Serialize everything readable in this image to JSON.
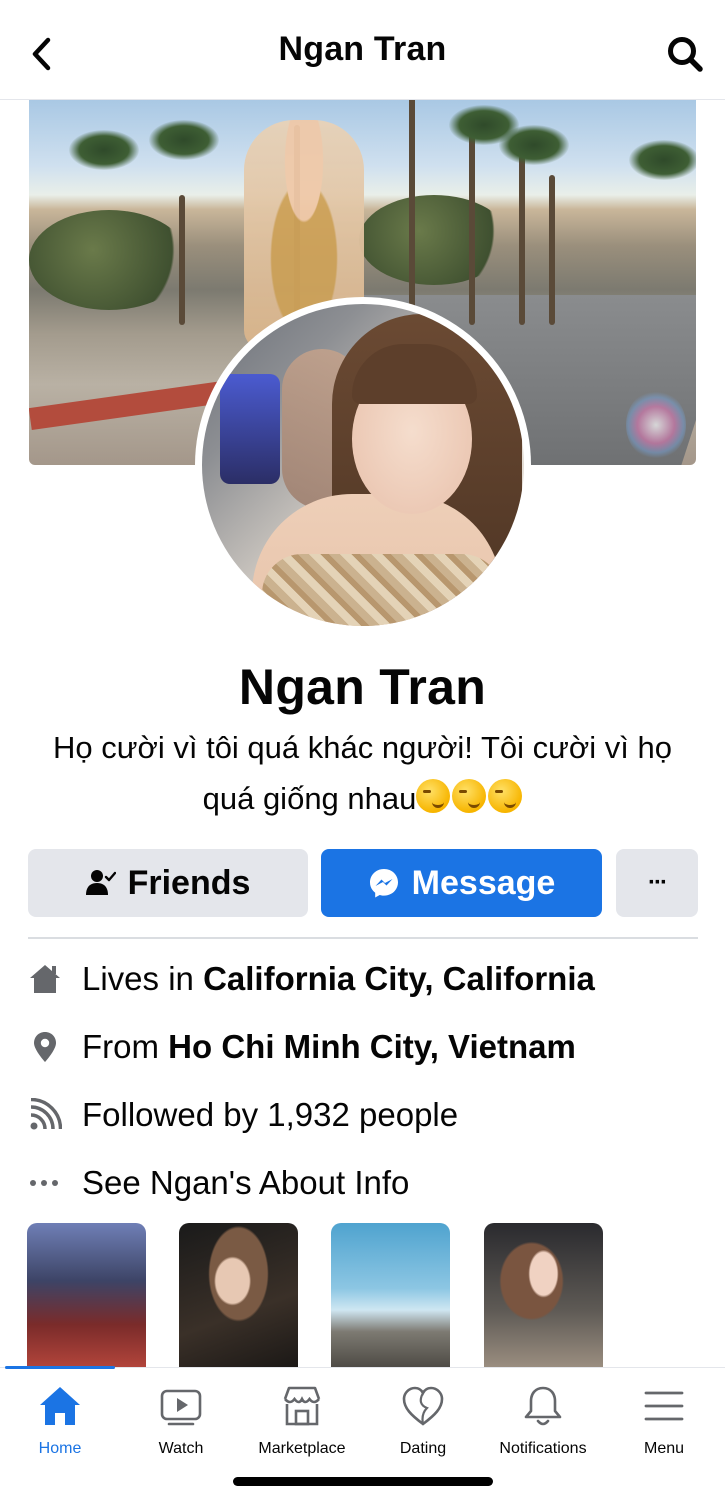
{
  "header": {
    "title": "Ngan Tran"
  },
  "profile": {
    "name": "Ngan Tran",
    "bio_line1": "Họ cười vì tôi quá khác người! Tôi cười vì họ",
    "bio_line2": "quá giống nhau"
  },
  "actions": {
    "friends_label": "Friends",
    "message_label": "Message",
    "more_label": "···"
  },
  "info": {
    "lives_prefix": "Lives in ",
    "lives_value": "California City, California",
    "from_prefix": "From ",
    "from_value": "Ho Chi Minh City, Vietnam",
    "followed": "Followed by 1,932 people",
    "about": "See Ngan's About Info"
  },
  "tabbar": {
    "tabs": [
      {
        "label": "Home",
        "icon": "home-icon",
        "active": true
      },
      {
        "label": "Watch",
        "icon": "watch-icon"
      },
      {
        "label": "Marketplace",
        "icon": "marketplace-icon"
      },
      {
        "label": "Dating",
        "icon": "dating-icon"
      },
      {
        "label": "Notifications",
        "icon": "bell-icon"
      },
      {
        "label": "Menu",
        "icon": "menu-icon"
      }
    ]
  },
  "colors": {
    "accent": "#1b74e4",
    "button_gray": "#e4e6eb",
    "text": "#050505"
  }
}
